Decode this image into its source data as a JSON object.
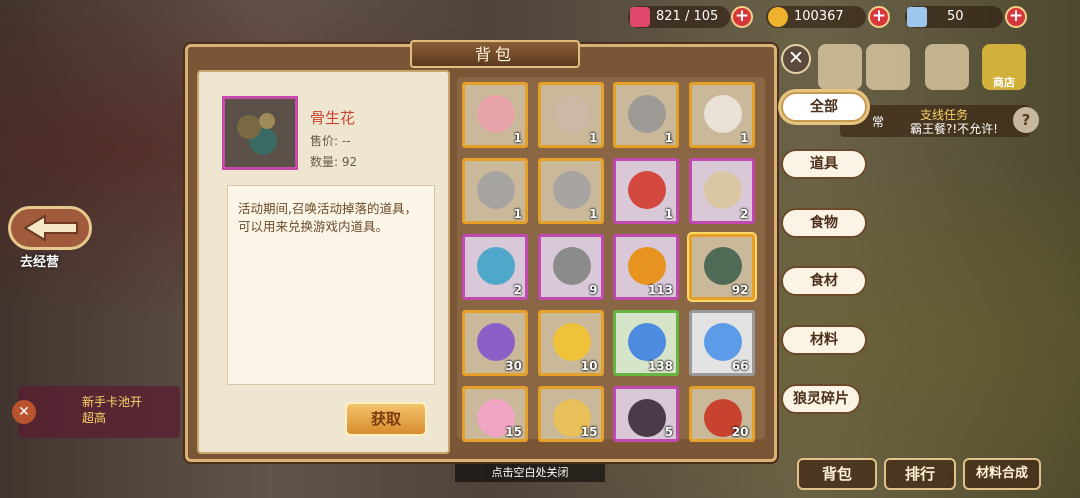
{
  "currencies": [
    {
      "icon": "heart-icon",
      "value": "821 / 105",
      "color": "#e0476b"
    },
    {
      "icon": "gold-coin-icon",
      "value": "100367",
      "color": "#f0b22e"
    },
    {
      "icon": "crystal-icon",
      "value": "50",
      "color": "#9ec7ef"
    }
  ],
  "panel": {
    "title": "背包"
  },
  "detail": {
    "name": "骨生花",
    "price": "售价: --",
    "quantity": "数量: 92",
    "description": "活动期间,召唤活动掉落的道具，可以用来兑换游戏内道具。",
    "obtain_label": "获取"
  },
  "items": [
    {
      "icon": "pouch-icon",
      "qty": "1",
      "rarity": "o",
      "color": "#e7a3a8"
    },
    {
      "icon": "hamster-icon",
      "qty": "1",
      "rarity": "o",
      "color": "#cbb8a5"
    },
    {
      "icon": "chinchilla-icon",
      "qty": "1",
      "rarity": "o",
      "color": "#9d9a96"
    },
    {
      "icon": "tabby-cat-icon",
      "qty": "1",
      "rarity": "o",
      "color": "#e9e0d6"
    },
    {
      "icon": "chinchilla-pink-icon",
      "qty": "1",
      "rarity": "o",
      "color": "#a7a3a1"
    },
    {
      "icon": "chinchilla-green-icon",
      "qty": "1",
      "rarity": "o",
      "color": "#a7a3a1"
    },
    {
      "icon": "star-token-icon",
      "qty": "1",
      "rarity": "p",
      "color": "#d3483f"
    },
    {
      "icon": "book-icon",
      "qty": "2",
      "rarity": "p",
      "color": "#d9c7a4"
    },
    {
      "icon": "wind-charm-icon",
      "qty": "2",
      "rarity": "p",
      "color": "#4fa7c9"
    },
    {
      "icon": "sword-icon",
      "qty": "9",
      "rarity": "p",
      "color": "#8b8b8b"
    },
    {
      "icon": "flame-icon",
      "qty": "113",
      "rarity": "p",
      "color": "#e79320"
    },
    {
      "icon": "bone-flower-icon",
      "qty": "92",
      "rarity": "o",
      "color": "#4f6a55",
      "selected": true
    },
    {
      "icon": "gift-box-icon",
      "qty": "30",
      "rarity": "o",
      "color": "#8b5fc7"
    },
    {
      "icon": "ticket-icon",
      "qty": "10",
      "rarity": "o",
      "color": "#f0c23a"
    },
    {
      "icon": "potion-bottle-icon",
      "qty": "138",
      "rarity": "g",
      "color": "#4d8be0"
    },
    {
      "icon": "vial-icon",
      "qty": "66",
      "rarity": "s",
      "color": "#5b9be8"
    },
    {
      "icon": "pink-hair-portrait-icon",
      "qty": "15",
      "rarity": "o",
      "color": "#f0a5c4"
    },
    {
      "icon": "blonde-portrait-icon",
      "qty": "15",
      "rarity": "o",
      "color": "#e8c15a"
    },
    {
      "icon": "dark-hair-portrait-icon",
      "qty": "5",
      "rarity": "p",
      "color": "#4b3a4a"
    },
    {
      "icon": "red-hair-portrait-icon",
      "qty": "20",
      "rarity": "o",
      "color": "#c8432f"
    }
  ],
  "categories": [
    "全部",
    "道具",
    "食物",
    "食材",
    "材料",
    "狼灵碎片"
  ],
  "top_icons": [
    {
      "icon": "activity-icon",
      "label": ""
    },
    {
      "icon": "mailbox-icon",
      "label": ""
    },
    {
      "icon": "event-icon",
      "label": ""
    },
    {
      "icon": "shop-icon",
      "label": "商店"
    }
  ],
  "quest": {
    "type": "支线任务",
    "title": "霸王餐?!不允许!",
    "tag": "常"
  },
  "bottom": {
    "bag": "背包",
    "rank": "排行",
    "synth": "材料合成"
  },
  "hint": "点击空白处关闭",
  "back_label": "去经营",
  "promo": {
    "line1": "新手卡池开",
    "line2": "超高"
  }
}
